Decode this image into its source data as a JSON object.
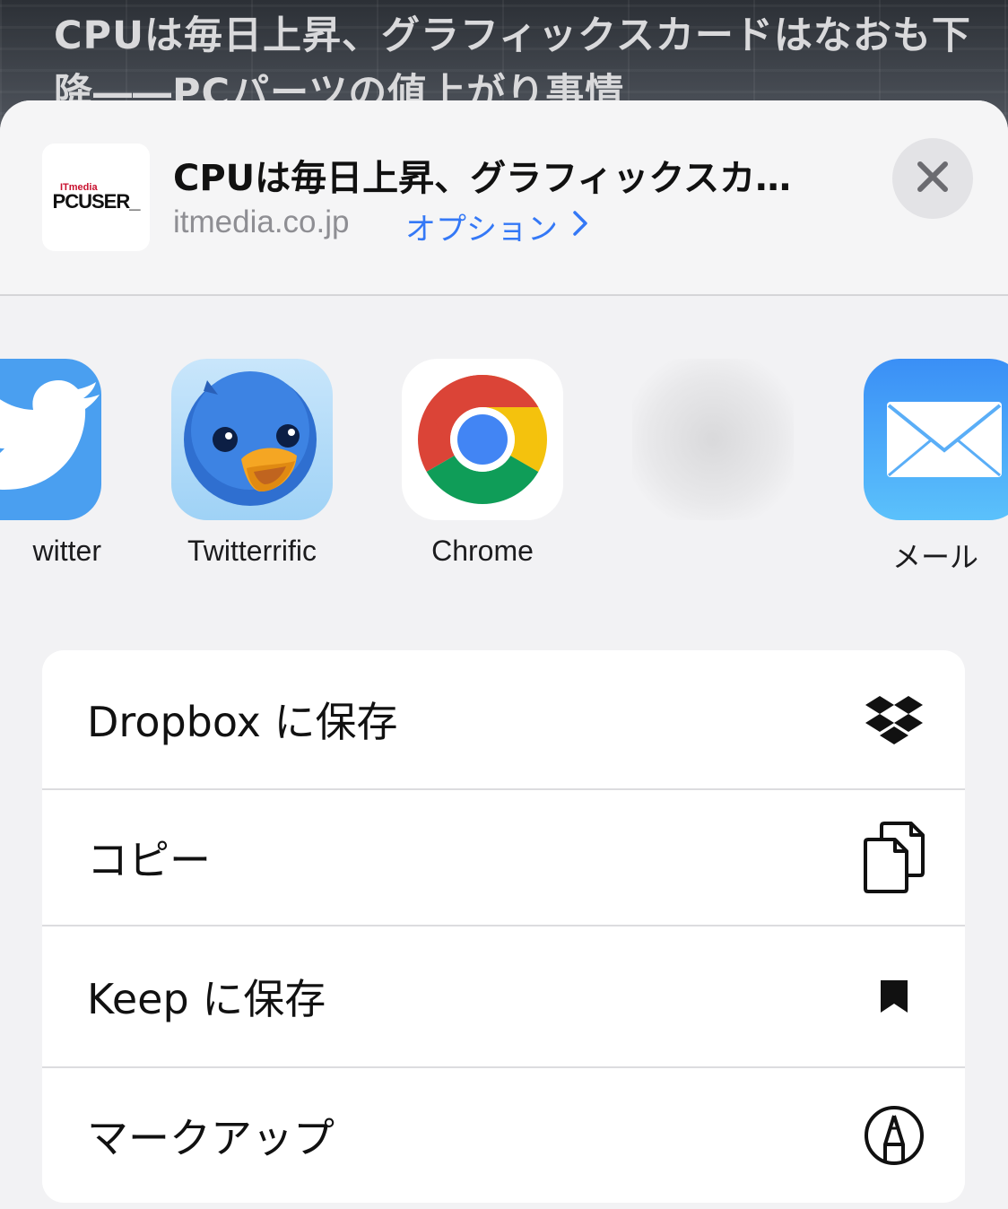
{
  "background": {
    "headline": "CPUは毎日上昇、グラフィックスカードはなおも下降――PCパーツの値上がり事情"
  },
  "sheet": {
    "site_icon": {
      "brand_small": "ITmedia",
      "brand_main": "PCUSER_"
    },
    "title": "CPUは毎日上昇、グラフィックスカードはなおも下降――PCパーツの値上がり事情",
    "domain": "itmedia.co.jp",
    "options_label": "オプション",
    "options_chevron": "chevron-right-icon",
    "close_icon": "close-icon"
  },
  "apps": [
    {
      "label": "witter",
      "icon": "twitter-bird-icon"
    },
    {
      "label": "Twitterrific",
      "icon": "twitterrific-bird-icon"
    },
    {
      "label": "Chrome",
      "icon": "chrome-icon"
    },
    {
      "label": "",
      "icon": "blurred-app-icon"
    },
    {
      "label": "メール",
      "icon": "mail-envelope-icon"
    }
  ],
  "actions": [
    {
      "label": "Dropbox に保存",
      "icon": "dropbox-icon"
    },
    {
      "label": "コピー",
      "icon": "copy-documents-icon"
    },
    {
      "label": "Keep に保存",
      "icon": "bookmark-icon"
    },
    {
      "label": "マークアップ",
      "icon": "markup-pen-icon"
    }
  ],
  "colors": {
    "accent": "#3478f6",
    "sheet_bg": "#f2f2f4",
    "twitter_blue": "#4a9ff0",
    "chrome_red": "#db4437",
    "chrome_yellow": "#f4c20d",
    "chrome_green": "#0f9d58",
    "chrome_blue": "#4285f4"
  }
}
